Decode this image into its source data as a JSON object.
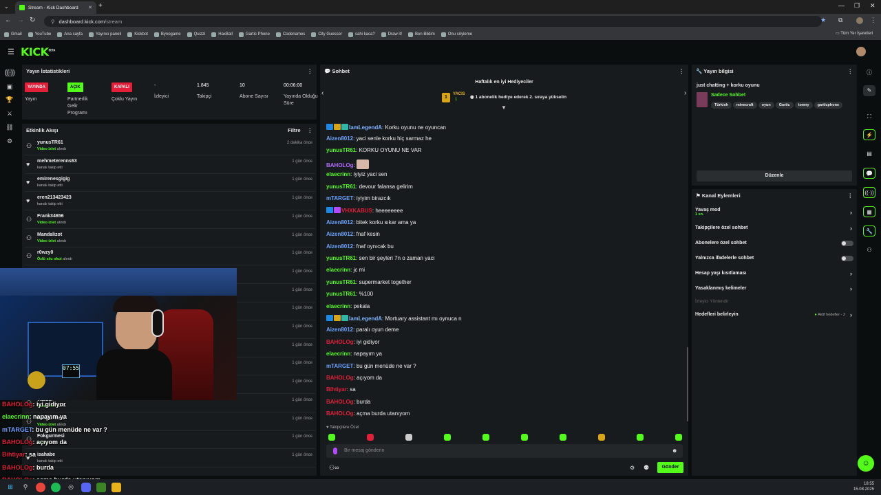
{
  "browser": {
    "tab_title": "Stream - Kick Dashboard",
    "url_domain": "dashboard.kick.com",
    "url_path": "/stream",
    "new_tab": "+",
    "bookmarks": [
      "Gmail",
      "YouTube",
      "Ana sayfa",
      "Yayıncı paneli",
      "Kickbot",
      "Bynogame",
      "Quizzi",
      "HaxBall",
      "Gartic Phone",
      "Codenames",
      "City Guesser",
      "sahi kaca?",
      "Draw it!",
      "Ben Bildim",
      "Onu söyleme"
    ],
    "bookmarks_right": "Tüm Yer İşaretleri"
  },
  "header": {
    "logo": "KICK",
    "logo_sup": "BETA"
  },
  "stats_panel": {
    "title": "Yayın İstatistikleri",
    "items": [
      {
        "badge": "YAYINDA",
        "label": "Yayın",
        "color": "#e31f3a"
      },
      {
        "badge": "AÇIK",
        "label": "Partnerlik Gelir Programı",
        "color": "#53fc18"
      },
      {
        "badge": "KAPALI",
        "label": "Çoklu Yayın",
        "color": "#e31f3a"
      },
      {
        "value": "-",
        "label": "İzleyici"
      },
      {
        "value": "1.845",
        "label": "Takipçi"
      },
      {
        "value": "10",
        "label": "Abone Sayısı"
      },
      {
        "value": "00:06:00",
        "label": "Yayında Olduğu Süre"
      }
    ]
  },
  "activity_panel": {
    "title": "Etkinlik Akışı",
    "filter": "Filtre",
    "rows": [
      {
        "name": "yunusTR61",
        "action_bold": "Video izlet",
        "action": " alındı",
        "time": "2 dakika önce",
        "icon": "gift"
      },
      {
        "name": "mehmeterenns63",
        "action_bold": "",
        "action": "kanalı takip etti",
        "time": "1 gün önce",
        "icon": "heart"
      },
      {
        "name": "emirenesgigig",
        "action_bold": "",
        "action": "kanalı takip etti",
        "time": "1 gün önce",
        "icon": "heart"
      },
      {
        "name": "eren213423423",
        "action_bold": "",
        "action": "kanalı takip etti",
        "time": "1 gün önce",
        "icon": "heart"
      },
      {
        "name": "Frank34656",
        "action_bold": "Video izlet",
        "action": " alındı",
        "time": "1 gün önce",
        "icon": "gift"
      },
      {
        "name": "Mandalizot",
        "action_bold": "Video izlet",
        "action": " alındı",
        "time": "1 gün önce",
        "icon": "gift"
      },
      {
        "name": "r0wzy0",
        "action_bold": "Özlü söz okut",
        "action": " alındı",
        "time": "1 gün önce",
        "icon": "gift"
      },
      {
        "name": "",
        "action_bold": "",
        "action": "",
        "time": "1 gün önce",
        "icon": ""
      },
      {
        "name": "",
        "action_bold": "",
        "action": "",
        "time": "1 gün önce",
        "icon": ""
      },
      {
        "name": "",
        "action_bold": "",
        "action": "",
        "time": "1 gün önce",
        "icon": ""
      },
      {
        "name": "",
        "action_bold": "",
        "action": "",
        "time": "1 gün önce",
        "icon": ""
      },
      {
        "name": "",
        "action_bold": "",
        "action": "",
        "time": "1 gün önce",
        "icon": ""
      },
      {
        "name": "",
        "action_bold": "",
        "action": "",
        "time": "1 gün önce",
        "icon": ""
      },
      {
        "name": "",
        "action_bold": "",
        "action": "",
        "time": "1 gün önce",
        "icon": ""
      },
      {
        "name": "Vasbsi",
        "action_bold": "Video izlet",
        "action": " alındı",
        "time": "1 gün önce",
        "icon": "gift"
      },
      {
        "name": "Fokgurmesi",
        "action_bold": "Video izlet",
        "action": " alındı",
        "time": "1 gün önce",
        "icon": "gift"
      },
      {
        "name": "Fokgurmesi",
        "action_bold": "su iç",
        "action": " alındı",
        "time": "1 gün önce",
        "icon": "gift"
      },
      {
        "name": "isahabe",
        "action_bold": "",
        "action": "kanalı takip etti",
        "time": "1 gün önce",
        "icon": "heart"
      }
    ]
  },
  "webcam": {
    "clock": "07:55"
  },
  "chat_panel": {
    "title": "Sohbet",
    "gifters_title": "Haftalık en iyi Hediyeciler",
    "gifter_name": "YACIS",
    "gifter_count": "1",
    "gifter_note": "1 abonelik hediye ederek 2. sıraya yükselin",
    "followers_only": "Takipçilere Özel",
    "input_placeholder": "Bir mesaj gönderin",
    "send": "Gönder",
    "infinity": "∞",
    "messages": [
      {
        "user": "IamLegendA",
        "text": "Korku oyunu ne oyuncan",
        "color": "#7fb4ff",
        "badges": 3
      },
      {
        "user": "Aizen8012",
        "text": "yaci senle korku hiç sarmaz he",
        "color": "#6ba3ff",
        "badges": 0
      },
      {
        "user": "yunusTR61",
        "text": "KORKU OYUNU NE VAR",
        "color": "#53fc18",
        "badges": 0
      },
      {
        "user": "BAHOLOg",
        "text": "",
        "color": "#b36bff",
        "badges": 0,
        "emote": true
      },
      {
        "user": "elaecrinn",
        "text": "iyiyiz yaci sen",
        "color": "#53fc18",
        "badges": 0
      },
      {
        "user": "yunusTR61",
        "text": "devour falansa gelirim",
        "color": "#53fc18",
        "badges": 0
      },
      {
        "user": "mTARGET",
        "text": "iyiyim birazcık",
        "color": "#6ba3ff",
        "badges": 0
      },
      {
        "user": "VHXKABUS",
        "text": "heeeeeeee",
        "color": "#e31f3a",
        "badges": 2
      },
      {
        "user": "Aizen8012",
        "text": "bitek korku sıkar ama ya",
        "color": "#6ba3ff",
        "badges": 0
      },
      {
        "user": "Aizen8012",
        "text": "fnaf kesin",
        "color": "#6ba3ff",
        "badges": 0
      },
      {
        "user": "Aizen8012",
        "text": "fnaf oynıcak bu",
        "color": "#6ba3ff",
        "badges": 0
      },
      {
        "user": "yunusTR61",
        "text": "sen bir şeyleri 7n o zaman yaci",
        "color": "#53fc18",
        "badges": 0
      },
      {
        "user": "elaecrinn",
        "text": "jc mi",
        "color": "#53fc18",
        "badges": 0
      },
      {
        "user": "yunusTR61",
        "text": "supermarket together",
        "color": "#53fc18",
        "badges": 0
      },
      {
        "user": "yunusTR61",
        "text": "%100",
        "color": "#53fc18",
        "badges": 0
      },
      {
        "user": "elaecrinn",
        "text": "pekala",
        "color": "#53fc18",
        "badges": 0
      },
      {
        "user": "IamLegendA",
        "text": "Mortuary assistant mı oynuca n",
        "color": "#7fb4ff",
        "badges": 3
      },
      {
        "user": "Aizen8012",
        "text": "paralı oyun deme",
        "color": "#6ba3ff",
        "badges": 0
      },
      {
        "user": "BAHOLOg",
        "text": "iyi gidiyor",
        "color": "#e31f3a",
        "badges": 0
      },
      {
        "user": "elaecrinn",
        "text": "napayım ya",
        "color": "#53fc18",
        "badges": 0
      },
      {
        "user": "mTARGET",
        "text": "bu gün menüde ne var ?",
        "color": "#6ba3ff",
        "badges": 0
      },
      {
        "user": "BAHOLOg",
        "text": "açıyom da",
        "color": "#e31f3a",
        "badges": 0
      },
      {
        "user": "Bihtiyar",
        "text": "sa",
        "color": "#e31f3a",
        "badges": 0
      },
      {
        "user": "BAHOLOg",
        "text": "burda",
        "color": "#e31f3a",
        "badges": 0
      },
      {
        "user": "BAHOLOg",
        "text": "açma burda utanıyom",
        "color": "#e31f3a",
        "badges": 0
      }
    ]
  },
  "overlay_chat": [
    {
      "user": "BAHOLOg",
      "text": "iyi gidiyor",
      "color": "#e31f3a"
    },
    {
      "user": "elaecrinn",
      "text": "napayım ya",
      "color": "#53fc18"
    },
    {
      "user": "mTARGET",
      "text": "bu gün menüde ne var ?",
      "color": "#6ba3ff"
    },
    {
      "user": "BAHOLOg",
      "text": "açıyom da",
      "color": "#e31f3a"
    },
    {
      "user": "Bihtiyar",
      "text": "sa",
      "color": "#e31f3a"
    },
    {
      "user": "BAHOLOg",
      "text": "burda",
      "color": "#e31f3a"
    },
    {
      "user": "BAHOLOg",
      "text": "açma burda utanıyom",
      "color": "#e31f3a"
    }
  ],
  "stream_info": {
    "title": "Yayın bilgisi",
    "stream_title": "just chatting + korku oyunu",
    "category": "Sadece Sohbet",
    "tags": [
      "Türkish",
      "minecraft",
      "oyun",
      "Gartic",
      "towny",
      "garticphone"
    ],
    "edit": "Düzenle"
  },
  "channel_actions": {
    "title": "Kanal Eylemleri",
    "slow_mode": "Yavaş mod",
    "slow_mode_value": "1 sn.",
    "followers_chat": "Takipçilere özel sohbet",
    "subs_chat": "Abonelere özel sohbet",
    "emotes_chat": "Yalnızca ifadelerle sohbet",
    "account_age": "Hesap yaşı kısıtlaması",
    "banned_words": "Yasaklanmış kelimeler",
    "viewer_redirect": "İzleyici Yönlendir",
    "goals": "Hedefleri belirleyin",
    "goals_status": "Aktif hedefler - 2"
  },
  "taskbar": {
    "time": "18:55",
    "date": "15.08.2025"
  }
}
